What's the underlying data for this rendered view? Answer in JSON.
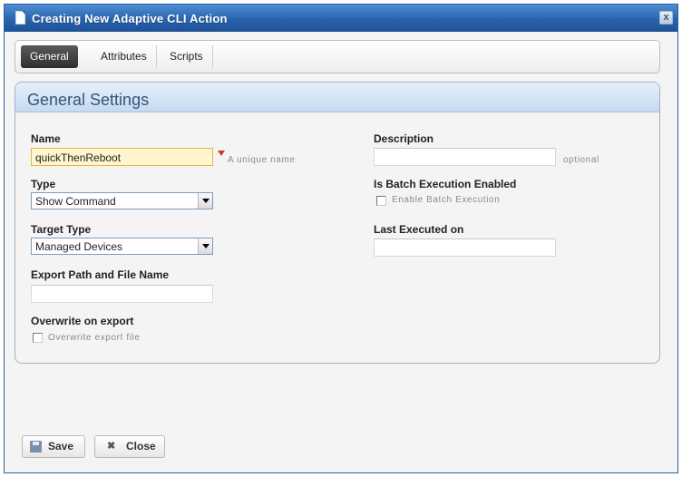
{
  "window": {
    "title": "Creating New Adaptive CLI Action",
    "close_glyph": "x"
  },
  "tabs": [
    {
      "label": "General",
      "active": true
    },
    {
      "label": "Attributes",
      "active": false
    },
    {
      "label": "Scripts",
      "active": false
    }
  ],
  "panel": {
    "title": "General Settings"
  },
  "fields": {
    "name": {
      "label": "Name",
      "value": "quickThenReboot",
      "hint": "A unique name"
    },
    "type": {
      "label": "Type",
      "value": "Show Command"
    },
    "target_type": {
      "label": "Target Type",
      "value": "Managed Devices"
    },
    "export_path": {
      "label": "Export Path and File Name",
      "value": ""
    },
    "overwrite": {
      "label": "Overwrite on export",
      "checkbox_label": "Overwrite export file",
      "checked": false
    },
    "description": {
      "label": "Description",
      "value": "",
      "hint": "optional"
    },
    "batch": {
      "label": "Is Batch Execution Enabled",
      "checkbox_label": "Enable Batch Execution",
      "checked": false
    },
    "last_executed": {
      "label": "Last Executed on",
      "value": ""
    }
  },
  "buttons": {
    "save": "Save",
    "close": "Close"
  },
  "icons": {
    "title": "document-icon",
    "save": "floppy-disk-icon",
    "close": "x-icon",
    "required": "required-flag-icon"
  },
  "colors": {
    "titlebar": "#2a64ad",
    "highlight_field": "#fff6cf",
    "panel_title": "#33557a"
  }
}
